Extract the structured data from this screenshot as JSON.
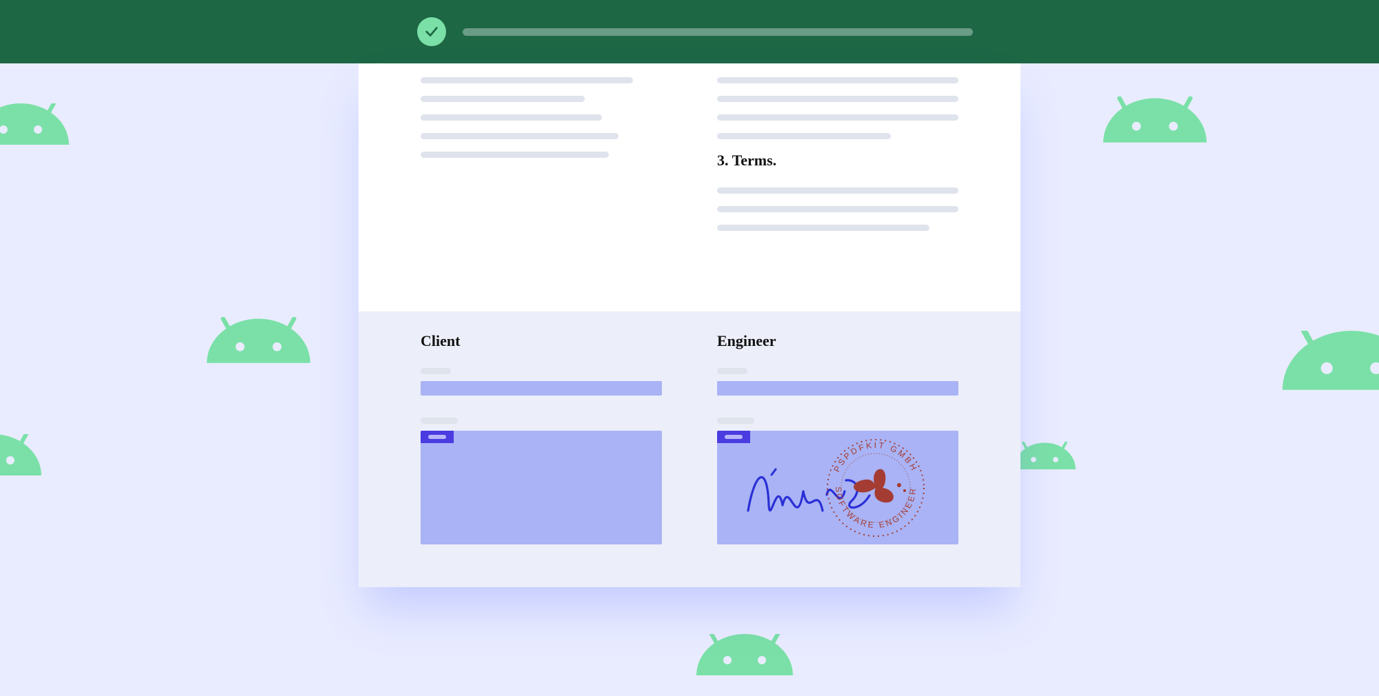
{
  "statusbar": {
    "state": "success"
  },
  "document": {
    "sections": {
      "terms_heading": "3. Terms."
    },
    "signature": {
      "client": {
        "title": "Client"
      },
      "engineer": {
        "title": "Engineer",
        "signature_name": "John A.",
        "stamp_top": "PSPDFKIT GMBH",
        "stamp_bottom": "SOFTWARE ENGINEER"
      }
    }
  }
}
